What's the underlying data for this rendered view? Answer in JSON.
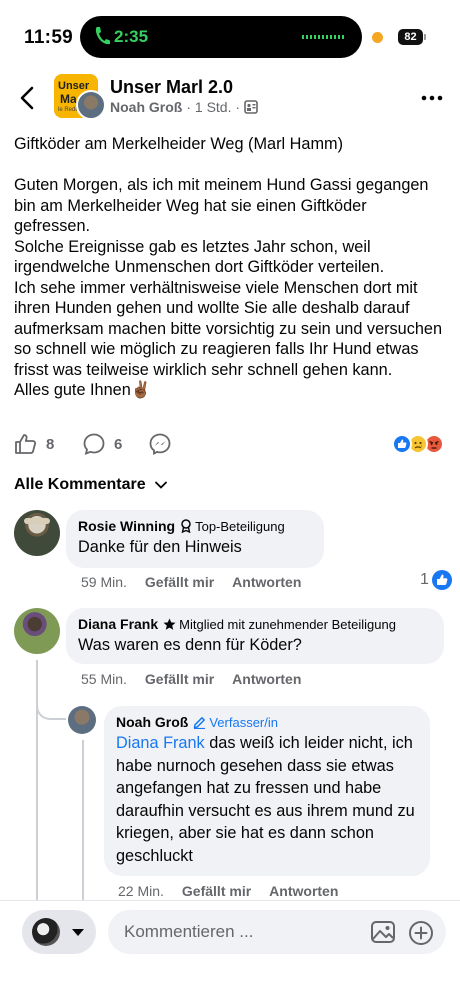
{
  "status_bar": {
    "time": "11:59",
    "call_time": "2:35",
    "battery": "82",
    "call_color": "#35d160"
  },
  "header": {
    "group_name": "Unser Marl 2.0",
    "group_logo_lines": [
      "Unser",
      "Ma",
      "le Redd"
    ],
    "author": "Noah Groß",
    "time": "· 1 Std. ·",
    "icons": [
      "back-arrow-icon",
      "group-privacy-icon",
      "more-icon"
    ]
  },
  "post": {
    "text": "Giftköder am Merkelheider Weg (Marl Hamm)\n\nGuten Morgen, als ich mit meinem Hund Gassi gegangen bin am Merkelheider Weg hat sie einen Giftköder gefressen.\nSolche Ereignisse gab es letztes Jahr schon, weil irgendwelche Unmenschen dort Giftköder verteilen.\nIch sehe immer verhältnisweise viele Menschen dort mit ihren Hunden gehen und wollte Sie alle deshalb darauf aufmerksam machen bitte vorsichtig zu sein und versuchen so schnell wie möglich zu reagieren falls Ihr Hund etwas frisst was teilweise wirklich sehr schnell gehen kann.\nAlles gute Ihnen✌🏾",
    "likes": "8",
    "comments": "6",
    "reactions": [
      "like",
      "sad",
      "angry"
    ]
  },
  "comments_section": {
    "filter_label": "Alle Kommentare"
  },
  "comments": [
    {
      "name": "Rosie Winning",
      "badge": "Top-Beteiligung",
      "text": "Danke für den Hinweis",
      "age": "59 Min.",
      "like_label": "Gefällt mir",
      "reply_label": "Antworten",
      "like_count": "1"
    },
    {
      "name": "Diana Frank",
      "badge": "Mitglied mit zunehmender Beteiligung",
      "text": "Was waren es denn für Köder?",
      "age": "55 Min.",
      "like_label": "Gefällt mir",
      "reply_label": "Antworten"
    },
    {
      "name": "Noah Groß",
      "badge": "Verfasser/in",
      "mention": "Diana Frank",
      "text": " das weiß ich leider nicht, ich habe nurnoch gesehen dass sie etwas angefangen hat zu fressen und habe daraufhin versucht es aus ihrem mund zu kriegen, aber sie hat es dann schon geschluckt",
      "age": "22 Min.",
      "like_label": "Gefällt mir",
      "reply_label": "Antworten"
    }
  ],
  "composer": {
    "placeholder": "Kommentieren ..."
  },
  "colors": {
    "accent": "#1877f2",
    "secondary_text": "#65676b",
    "bubble": "#f0f2f5"
  }
}
